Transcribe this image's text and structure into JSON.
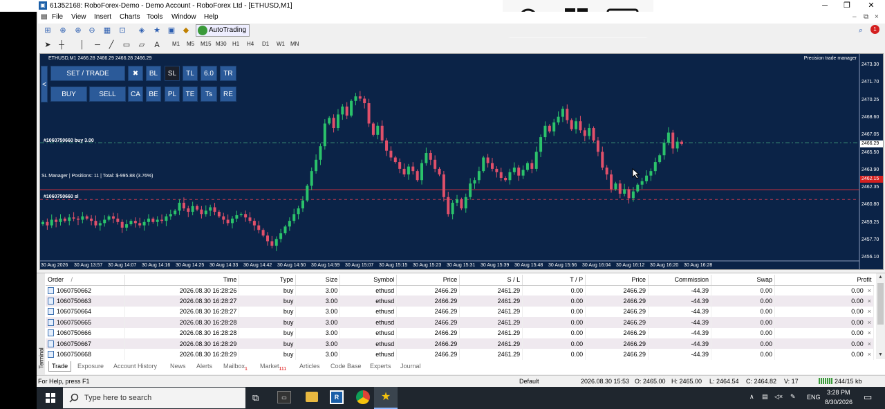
{
  "window": {
    "title": "61352168: RoboForex-Demo - Demo Account - RoboForex Ltd - [ETHUSD,M1]",
    "minimize_glyph": "─",
    "maximize_glyph": "❐",
    "close_glyph": "✕"
  },
  "overlay": {
    "icons": [
      "zoom-in-icon",
      "windows-icon",
      "keyboard-icon"
    ]
  },
  "menu": {
    "items": [
      "File",
      "View",
      "Insert",
      "Charts",
      "Tools",
      "Window",
      "Help"
    ]
  },
  "toolbar": {
    "autotrading_label": "AutoTrading",
    "timeframes": [
      "M1",
      "M5",
      "M15",
      "M30",
      "H1",
      "H4",
      "D1",
      "W1",
      "MN"
    ],
    "tool_a_label": "A",
    "notification_count": "1"
  },
  "chart": {
    "header": "ETHUSD,M1  2466.28 2466.29 2466.28 2466.29",
    "precision_label": "Precision  trade manager",
    "panel": {
      "collapse_label": "<",
      "row1": [
        "SET / TRADE",
        "✖",
        "BL",
        "SL",
        "TL",
        "6.0",
        "TR"
      ],
      "row2": [
        "BUY",
        "SELL",
        "CA",
        "BE",
        "PL",
        "TE",
        "Ts",
        "RE"
      ]
    },
    "line_labels": {
      "buy_line": "#1060750660 buy 3.00",
      "sl_manager": "SL Manager | Positions: 11 | Total: $-995.88 (3.76%)",
      "sl_line": "#1060750660 sl"
    },
    "price_tags": {
      "current": "2466.29",
      "sl": "2462.15"
    },
    "y_ticks": [
      "2473.30",
      "2471.70",
      "2470.25",
      "2468.60",
      "2467.05",
      "2465.50",
      "2463.90",
      "2462.35",
      "2460.80",
      "2459.25",
      "2457.70",
      "2456.10"
    ],
    "x_ticks": [
      "30 Aug 2026",
      "30 Aug 13:57",
      "30 Aug 14:07",
      "30 Aug 14:16",
      "30 Aug 14:25",
      "30 Aug 14:33",
      "30 Aug 14:42",
      "30 Aug 14:50",
      "30 Aug 14:59",
      "30 Aug 15:07",
      "30 Aug 15:15",
      "30 Aug 15:23",
      "30 Aug 15:31",
      "30 Aug 15:39",
      "30 Aug 15:48",
      "30 Aug 15:56",
      "30 Aug 16:04",
      "30 Aug 16:12",
      "30 Aug 16:20",
      "30 Aug 16:28"
    ],
    "colors": {
      "background": "#0b2347",
      "bull": "#2bc26b",
      "bear": "#e0506a",
      "buy_line": "#3f9a7a",
      "sl_line": "#d43040",
      "sl_dash": "#c23a50"
    },
    "closes": [
      2459.3,
      2459.0,
      2459.5,
      2459.3,
      2459.6,
      2459.4,
      2459.7,
      2459.6,
      2459.5,
      2459.8,
      2459.6,
      2459.4,
      2459.0,
      2459.2,
      2459.5,
      2459.8,
      2459.6,
      2459.3,
      2458.8,
      2459.1,
      2459.4,
      2459.2,
      2459.0,
      2459.3,
      2459.6,
      2459.3,
      2459.5,
      2459.4,
      2459.8,
      2460.0,
      2460.3,
      2461.0,
      2460.5,
      2460.2,
      2460.7,
      2460.4,
      2460.0,
      2460.3,
      2460.6,
      2460.2,
      2459.8,
      2459.5,
      2459.2,
      2459.6,
      2459.9,
      2460.0,
      2459.7,
      2459.4,
      2459.0,
      2458.6,
      2458.1,
      2457.6,
      2457.2,
      2457.8,
      2458.3,
      2458.9,
      2459.4,
      2460.0,
      2460.5,
      2461.2,
      2462.5,
      2463.8,
      2464.8,
      2466.0,
      2468.0,
      2468.5,
      2467.6,
      2468.8,
      2469.5,
      2468.7,
      2470.0,
      2470.4,
      2470.2,
      2469.8,
      2468.0,
      2467.0,
      2467.8,
      2466.5,
      2465.6,
      2465.0,
      2464.6,
      2464.0,
      2463.5,
      2464.2,
      2463.8,
      2463.0,
      2464.5,
      2465.4,
      2464.8,
      2464.0,
      2463.5,
      2461.5,
      2460.0,
      2461.0,
      2461.3,
      2460.5,
      2461.5,
      2462.7,
      2463.0,
      2463.8,
      2465.0,
      2464.5,
      2464.0,
      2463.7,
      2463.2,
      2463.0,
      2463.7,
      2464.1,
      2463.4,
      2463.9,
      2464.5,
      2464.0,
      2465.5,
      2466.8,
      2467.8,
      2467.3,
      2468.1,
      2468.6,
      2469.3,
      2468.3,
      2467.5,
      2468.2,
      2467.4,
      2466.9,
      2467.6,
      2466.5,
      2465.5,
      2464.1,
      2463.5,
      2462.2,
      2462.7,
      2461.8,
      2462.2,
      2461.4,
      2462.0,
      2462.6,
      2462.9,
      2463.4,
      2463.8,
      2464.6,
      2465.2,
      2466.3,
      2467.2,
      2465.8,
      2466.4,
      2466.2
    ]
  },
  "terminal": {
    "side_label": "Terminal",
    "columns": [
      "Order",
      "Time",
      "Type",
      "Size",
      "Symbol",
      "Price",
      "S / L",
      "T / P",
      "Price",
      "Commission",
      "Swap",
      "Profit"
    ],
    "sort_glyph": "/",
    "close_glyph": "×",
    "rows": [
      [
        "1060750662",
        "2026.08.30 16:28:26",
        "buy",
        "3.00",
        "ethusd",
        "2466.29",
        "2461.29",
        "0.00",
        "2466.29",
        "-44.39",
        "0.00",
        "0.00"
      ],
      [
        "1060750663",
        "2026.08.30 16:28:27",
        "buy",
        "3.00",
        "ethusd",
        "2466.29",
        "2461.29",
        "0.00",
        "2466.29",
        "-44.39",
        "0.00",
        "0.00"
      ],
      [
        "1060750664",
        "2026.08.30 16:28:27",
        "buy",
        "3.00",
        "ethusd",
        "2466.29",
        "2461.29",
        "0.00",
        "2466.29",
        "-44.39",
        "0.00",
        "0.00"
      ],
      [
        "1060750665",
        "2026.08.30 16:28:28",
        "buy",
        "3.00",
        "ethusd",
        "2466.29",
        "2461.29",
        "0.00",
        "2466.29",
        "-44.39",
        "0.00",
        "0.00"
      ],
      [
        "1060750666",
        "2026.08.30 16:28:28",
        "buy",
        "3.00",
        "ethusd",
        "2466.29",
        "2461.29",
        "0.00",
        "2466.29",
        "-44.39",
        "0.00",
        "0.00"
      ],
      [
        "1060750667",
        "2026.08.30 16:28:29",
        "buy",
        "3.00",
        "ethusd",
        "2466.29",
        "2461.29",
        "0.00",
        "2466.29",
        "-44.39",
        "0.00",
        "0.00"
      ],
      [
        "1060750668",
        "2026.08.30 16:28:29",
        "buy",
        "3.00",
        "ethusd",
        "2466.29",
        "2461.29",
        "0.00",
        "2466.29",
        "-44.39",
        "0.00",
        "0.00"
      ]
    ],
    "tabs": [
      "Trade",
      "Exposure",
      "Account History",
      "News",
      "Alerts",
      "Mailbox",
      "Market",
      "Articles",
      "Code Base",
      "Experts",
      "Journal"
    ],
    "mailbox_badge": "1",
    "market_badge": "111"
  },
  "status": {
    "help": "For Help, press F1",
    "profile": "Default",
    "time": "2026.08.30 15:53",
    "open": "O: 2465.00",
    "high": "H: 2465.00",
    "low": "L: 2464.54",
    "close": "C: 2464.82",
    "volume": "V: 17",
    "traffic": "244/15 kb"
  },
  "taskbar": {
    "search_placeholder": "Type here to search",
    "lang": "ENG",
    "clock_time": "3:28 PM",
    "clock_date": "8/30/2026",
    "apps": [
      "task-view-icon",
      "terminal-app-icon",
      "file-explorer-icon",
      "roboforex-icon",
      "chrome-icon",
      "star-app-icon"
    ]
  }
}
